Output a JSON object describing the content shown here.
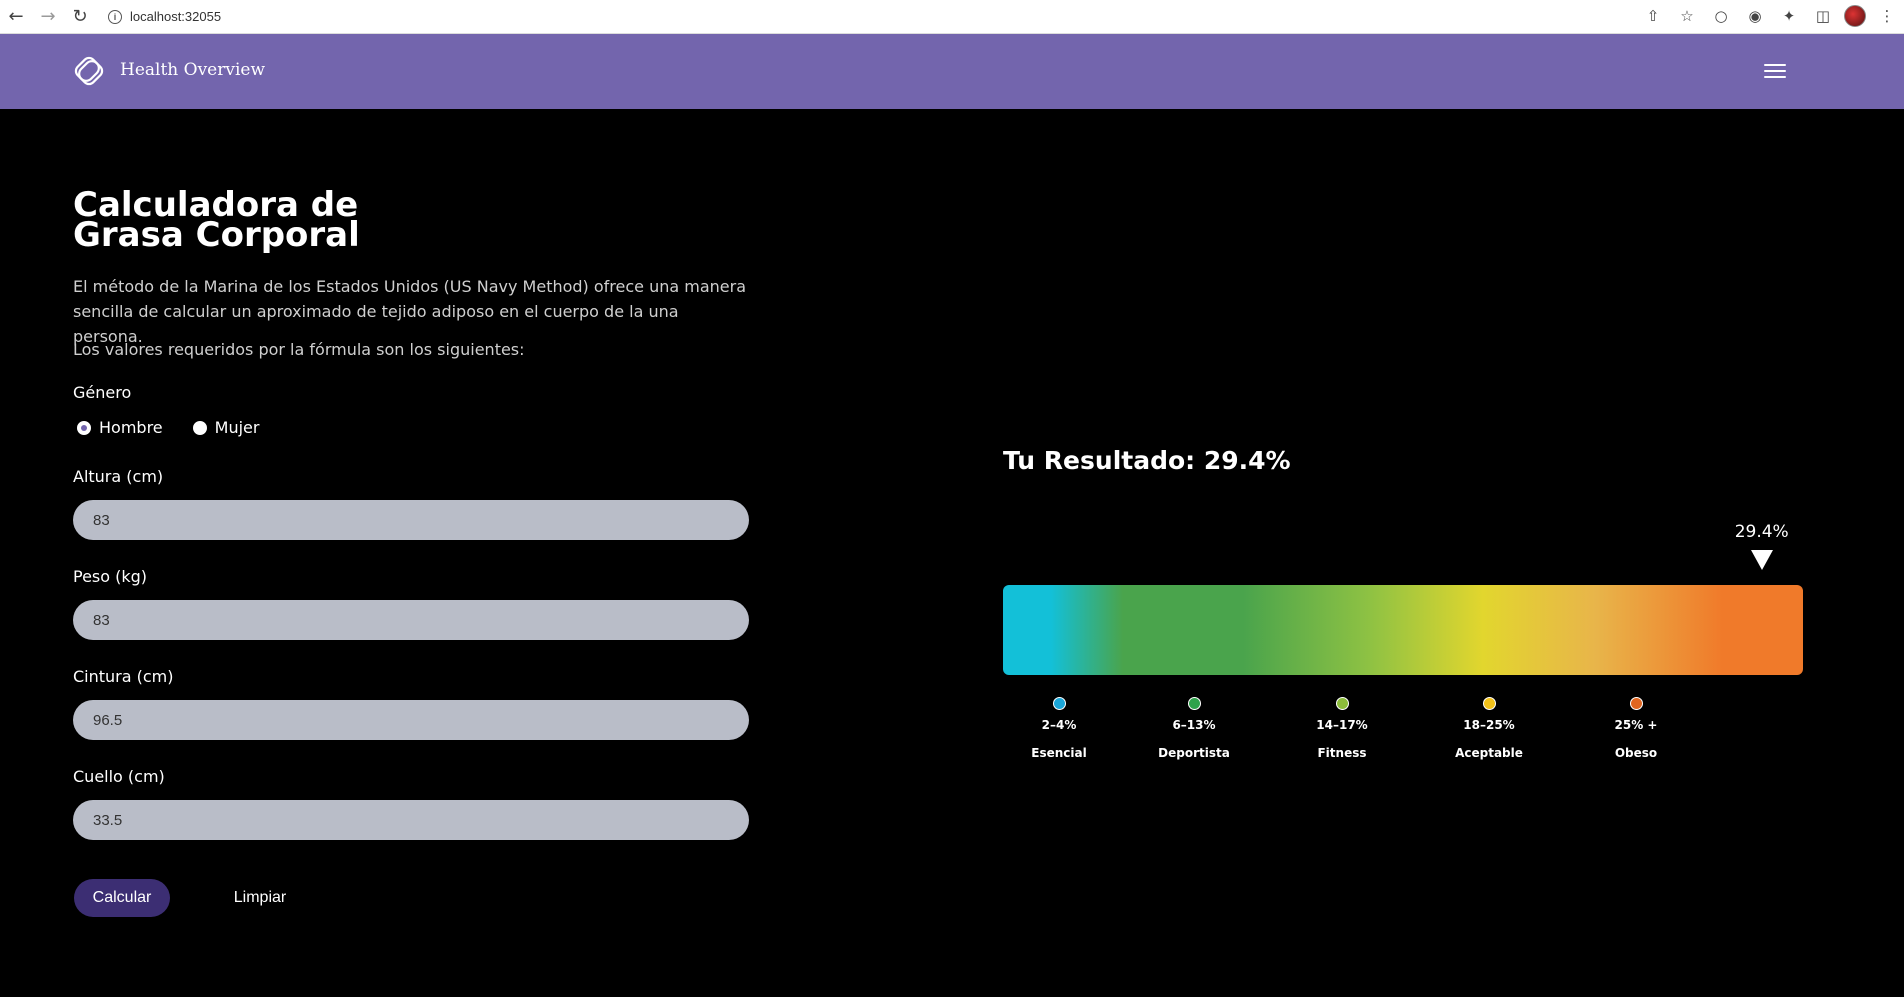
{
  "browser": {
    "url": "localhost:32055"
  },
  "header": {
    "title": "Health Overview"
  },
  "form": {
    "title": "Calculadora de Grasa Corporal",
    "description": "El método de la Marina de los Estados Unidos (US Navy Method) ofrece una manera sencilla de calcular un aproximado de tejido adiposo en el cuerpo de la una persona.",
    "instructions": "Los valores requeridos por la fórmula son los siguientes:",
    "gender_label": "Género",
    "gender_options": [
      {
        "label": "Hombre",
        "checked": true
      },
      {
        "label": "Mujer",
        "checked": false
      }
    ],
    "fields": [
      {
        "label": "Altura (cm)",
        "value": "83"
      },
      {
        "label": "Peso (kg)",
        "value": "83"
      },
      {
        "label": "Cintura (cm)",
        "value": "96.5"
      },
      {
        "label": "Cuello (cm)",
        "value": "33.5"
      }
    ],
    "calculate_label": "Calcular",
    "clear_label": "Limpiar"
  },
  "result": {
    "title": "Tu Resultado: 29.4%",
    "marker_label": "29.4%",
    "value_percent": 29.4,
    "categories": [
      {
        "range": "2–4%",
        "name": "Esencial",
        "color": "#1aa6d8"
      },
      {
        "range": "6–13%",
        "name": "Deportista",
        "color": "#2ea24a"
      },
      {
        "range": "14–17%",
        "name": "Fitness",
        "color": "#8cbc3b"
      },
      {
        "range": "18–25%",
        "name": "Aceptable",
        "color": "#f2c21a"
      },
      {
        "range": "25% +",
        "name": "Obeso",
        "color": "#e0651f"
      }
    ]
  },
  "colors": {
    "header_bg": "#7365ad",
    "primary_button": "#3c2e73",
    "input_bg": "#b9bdc8"
  }
}
